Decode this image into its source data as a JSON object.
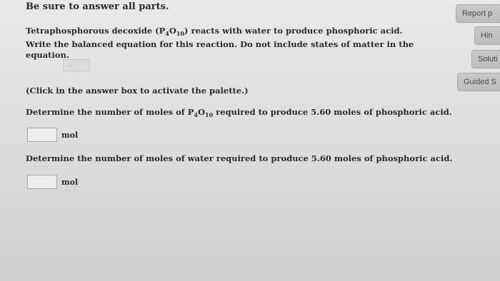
{
  "heading": "Be sure to answer all parts.",
  "question": {
    "t1": "Tetraphosphorous decoxide (P",
    "s1": "4",
    "t2": "O",
    "s2": "10",
    "t3": ") reacts with water to produce phosphoric acid. Write the balanced equation for this reaction. Do not include states of matter in the equation."
  },
  "equation_box_placeholder": "→",
  "palette_note": "(Click in the answer box to activate the palette.)",
  "part1": {
    "t1": "Determine the number of moles of P",
    "s1": "4",
    "t2": "O",
    "s2": "10",
    "t3": " required to produce 5.60 moles of phosphoric acid.",
    "unit": "mol"
  },
  "part2": {
    "text": "Determine the number of moles of water required to produce 5.60 moles of phosphoric acid.",
    "unit": "mol"
  },
  "sidebar": {
    "report": "Report p",
    "hint": "Hin",
    "solution": "Soluti",
    "guided": "Guided S"
  }
}
